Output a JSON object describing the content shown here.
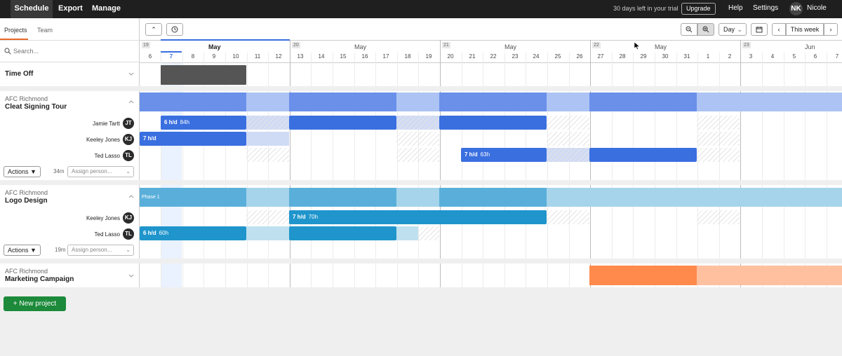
{
  "topbar": {
    "tabs": [
      "Schedule",
      "Export",
      "Manage"
    ],
    "trial_text": "30 days left in your trial",
    "upgrade_label": "Upgrade",
    "help_label": "Help",
    "settings_label": "Settings",
    "user_initials": "NK",
    "user_name": "Nicole"
  },
  "left_tabs": [
    "Projects",
    "Team"
  ],
  "search": {
    "placeholder": "Search..."
  },
  "toolbar": {
    "view_label": "Day",
    "range_label": "This week"
  },
  "timeline": {
    "weeks": [
      {
        "num": "19",
        "month": "May"
      },
      {
        "num": "20",
        "month": "May"
      },
      {
        "num": "21",
        "month": "May"
      },
      {
        "num": "22",
        "month": "May"
      },
      {
        "num": "23",
        "month": "Jun"
      }
    ],
    "days": [
      "6",
      "7",
      "8",
      "9",
      "10",
      "11",
      "12",
      "13",
      "14",
      "15",
      "16",
      "17",
      "18",
      "19",
      "20",
      "21",
      "22",
      "23",
      "24",
      "25",
      "26",
      "27",
      "28",
      "29",
      "30",
      "31",
      "1",
      "2",
      "3",
      "4",
      "5",
      "6",
      "7"
    ],
    "today": "7"
  },
  "time_off": {
    "label": "Time Off"
  },
  "projects": [
    {
      "client": "AFC Richmond",
      "name": "Cleat Signing Tour",
      "people": [
        {
          "name": "Jamie Tartt",
          "initials": "JT"
        },
        {
          "name": "Keeley Jones",
          "initials": "KJ"
        },
        {
          "name": "Ted Lasso",
          "initials": "TL"
        }
      ],
      "actions_label": "Actions",
      "minutes": "34m",
      "assign_placeholder": "Assign person...",
      "bars": [
        {
          "label": "6 h/d",
          "sub": "84h"
        },
        {
          "label": "7 h/d",
          "sub": ""
        },
        {
          "label": "7 h/d",
          "sub": "63h"
        }
      ]
    },
    {
      "client": "AFC Richmond",
      "name": "Logo Design",
      "phase": "Phase 1",
      "people": [
        {
          "name": "Keeley Jones",
          "initials": "KJ"
        },
        {
          "name": "Ted Lasso",
          "initials": "TL"
        }
      ],
      "actions_label": "Actions",
      "minutes": "19m",
      "assign_placeholder": "Assign person...",
      "bars": [
        {
          "label": "7 h/d",
          "sub": "70h"
        },
        {
          "label": "6 h/d",
          "sub": "60h"
        }
      ]
    },
    {
      "client": "AFC Richmond",
      "name": "Marketing Campaign"
    }
  ],
  "new_project_label": "New project",
  "colors": {
    "topbar": "#1f1f1f",
    "blue_dark": "#3a6fe0",
    "blue_mid": "#6a90ea",
    "blue_light": "#adc3f3",
    "teal_dark": "#1f95cc",
    "teal_mid": "#5aafda",
    "teal_light": "#a6d4ea",
    "orange": "#ff8a4c",
    "orange_light": "#ffc0a0",
    "green": "#1c8a3a"
  }
}
